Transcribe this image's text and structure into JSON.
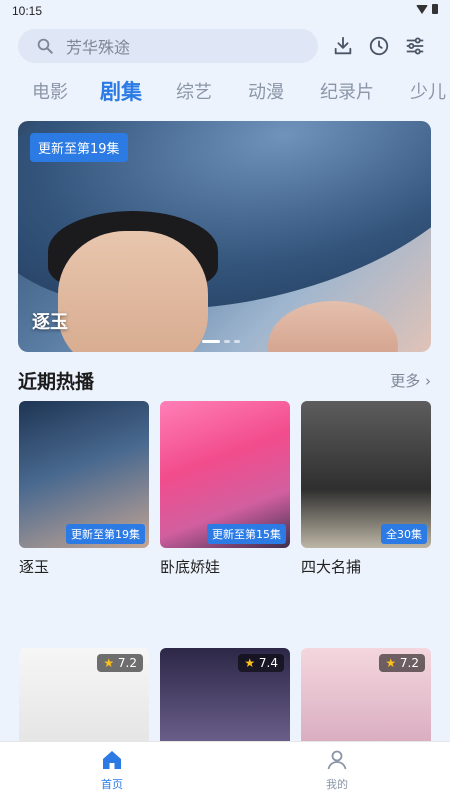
{
  "status": {
    "time": "10:15"
  },
  "search": {
    "placeholder": "芳华殊途"
  },
  "tabs": [
    {
      "label": "电影"
    },
    {
      "label": "剧集"
    },
    {
      "label": "综艺"
    },
    {
      "label": "动漫"
    },
    {
      "label": "纪录片"
    },
    {
      "label": "少儿"
    }
  ],
  "active_tab": "剧集",
  "banner": {
    "badge": "更新至第19集",
    "title": "逐玉"
  },
  "section": {
    "title": "近期热播",
    "more": "更多 ›"
  },
  "cards": [
    {
      "name": "逐玉",
      "badge": "更新至第19集"
    },
    {
      "name": "卧底娇娃",
      "badge": "更新至第15集"
    },
    {
      "name": "四大名捕",
      "badge": "全30集"
    }
  ],
  "ratings": [
    "7.2",
    "7.4",
    "7.2"
  ],
  "nav": {
    "home": "首页",
    "me": "我的"
  },
  "colors": {
    "accent": "#2c7be5",
    "background": "#edf3fd"
  }
}
